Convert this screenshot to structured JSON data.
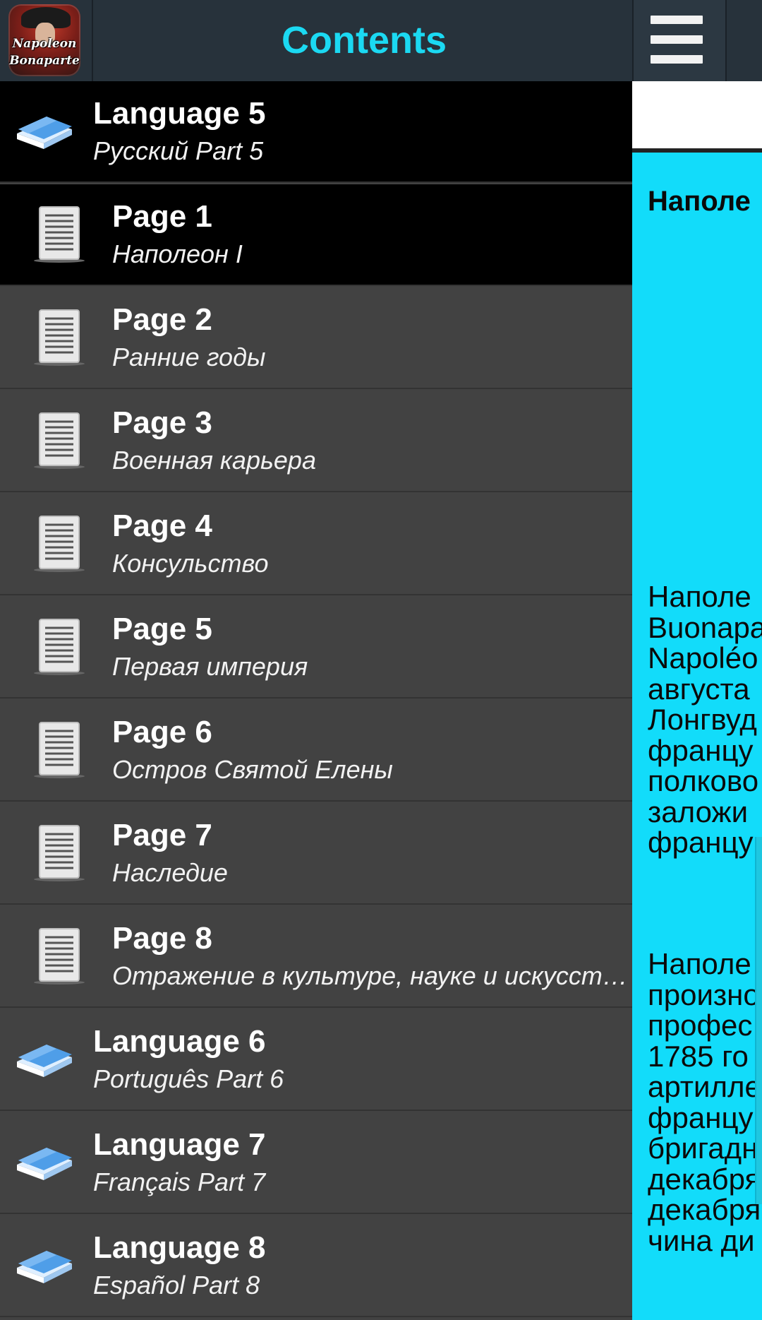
{
  "header": {
    "title": "Contents",
    "logo_text_line1": "Napoleon",
    "logo_text_line2": "Bonaparte"
  },
  "drawer": {
    "items": [
      {
        "title": "Language 5",
        "subtitle": "Русский Part 5",
        "icon": "book-icon"
      },
      {
        "title": "Page 1",
        "subtitle": "Наполеон I",
        "icon": "document-icon"
      },
      {
        "title": "Page 2",
        "subtitle": "Ранние годы",
        "icon": "document-icon"
      },
      {
        "title": "Page 3",
        "subtitle": "Военная карьера",
        "icon": "document-icon"
      },
      {
        "title": "Page 4",
        "subtitle": "Консульство",
        "icon": "document-icon"
      },
      {
        "title": "Page 5",
        "subtitle": "Первая империя",
        "icon": "document-icon"
      },
      {
        "title": "Page 6",
        "subtitle": "Остров Святой Елены",
        "icon": "document-icon"
      },
      {
        "title": "Page 7",
        "subtitle": "Наследие",
        "icon": "document-icon"
      },
      {
        "title": "Page 8",
        "subtitle": "Отражение в культуре, науке и искусстве",
        "icon": "document-icon"
      },
      {
        "title": "Language 6",
        "subtitle": "Português Part 6",
        "icon": "book-icon"
      },
      {
        "title": "Language 7",
        "subtitle": "Français Part 7",
        "icon": "book-icon"
      },
      {
        "title": "Language 8",
        "subtitle": "Español Part 8",
        "icon": "book-icon"
      }
    ]
  },
  "background_page": {
    "heading": "Наполе",
    "paragraph1": [
      "Наполе",
      "Buonapa",
      "Napoléo",
      "августа",
      "Лонгвуд",
      "францу",
      "полково",
      "заложи",
      "францу"
    ],
    "paragraph2": [
      "Наполе",
      "произно",
      "профес",
      "1785 го",
      "артилле",
      "францу",
      "бригадн",
      "декабря",
      "декабря",
      "чина ди"
    ]
  },
  "colors": {
    "accent": "#1bd9f2",
    "topbar": "#27323b",
    "drawer_bg": "#424242",
    "selected_bg": "#000000",
    "content_bg": "#12dcfa"
  }
}
